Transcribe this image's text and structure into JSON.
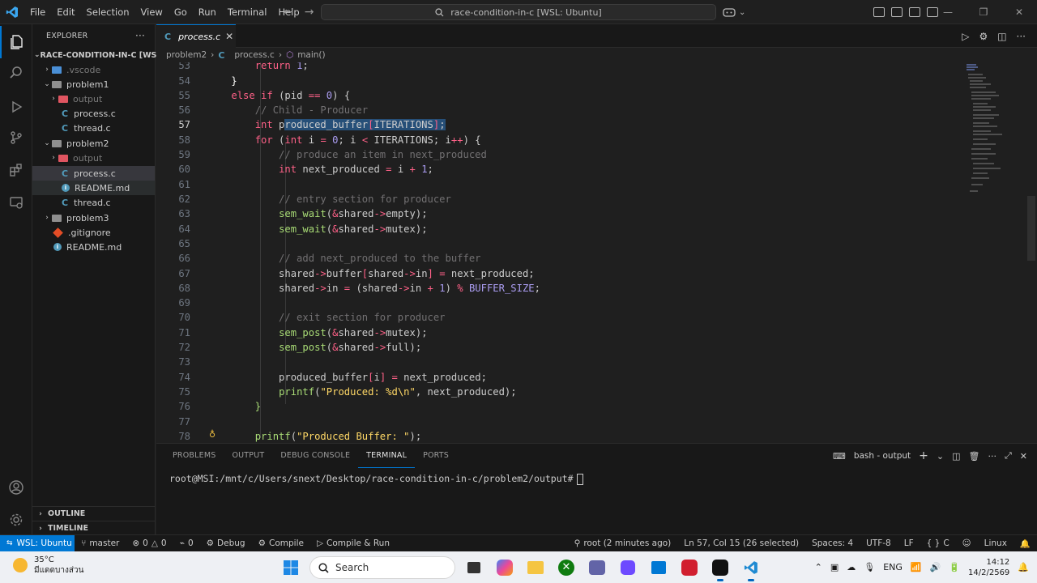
{
  "titlebar": {
    "menus": [
      "File",
      "Edit",
      "Selection",
      "View",
      "Go",
      "Run",
      "Terminal",
      "Help"
    ],
    "command_center": "race-condition-in-c [WSL: Ubuntu]"
  },
  "explorer": {
    "header": "EXPLORER",
    "root": "RACE-CONDITION-IN-C [WS...",
    "items": [
      {
        "label": ".vscode"
      },
      {
        "label": "problem1"
      },
      {
        "label": "output"
      },
      {
        "label": "process.c"
      },
      {
        "label": "thread.c"
      },
      {
        "label": "problem2"
      },
      {
        "label": "output"
      },
      {
        "label": "process.c"
      },
      {
        "label": "README.md"
      },
      {
        "label": "thread.c"
      },
      {
        "label": "problem3"
      },
      {
        "label": ".gitignore"
      },
      {
        "label": "README.md"
      }
    ],
    "outline": "OUTLINE",
    "timeline": "TIMELINE"
  },
  "editor": {
    "tab_title": "process.c",
    "breadcrumb": [
      "problem2",
      "process.c",
      "main()"
    ],
    "line_numbers": [
      "53",
      "54",
      "55",
      "56",
      "57",
      "58",
      "59",
      "60",
      "61",
      "62",
      "63",
      "64",
      "65",
      "66",
      "67",
      "68",
      "69",
      "70",
      "71",
      "72",
      "73",
      "74",
      "75",
      "76",
      "77",
      "78"
    ],
    "current_line": "57"
  },
  "panel": {
    "tabs": [
      "PROBLEMS",
      "OUTPUT",
      "DEBUG CONSOLE",
      "TERMINAL",
      "PORTS"
    ],
    "active_tab": "TERMINAL",
    "terminal_name": "bash - output",
    "prompt": "root@MSI:/mnt/c/Users/snext/Desktop/race-condition-in-c/problem2/output#"
  },
  "statusbar": {
    "remote": "WSL: Ubuntu",
    "branch": "master",
    "errors": "0",
    "warnings": "0",
    "ports": "0",
    "debug": "Debug",
    "compile": "Compile",
    "compile_run": "Compile & Run",
    "git_author": "root (2 minutes ago)",
    "cursor": "Ln 57, Col 15 (26 selected)",
    "spaces": "Spaces: 4",
    "encoding": "UTF-8",
    "eol": "LF",
    "language": "C",
    "platform": "Linux"
  },
  "taskbar": {
    "temperature": "35°C",
    "weather": "มีแดดบางส่วน",
    "search": "Search",
    "language": "ENG",
    "time": "14:12",
    "date": "14/2/2569"
  },
  "colors": {
    "accent": "#0078d4",
    "keyword": "#ff6188",
    "function": "#a9dc76",
    "number": "#ab9df2",
    "string": "#ffd866",
    "comment": "#727072"
  }
}
